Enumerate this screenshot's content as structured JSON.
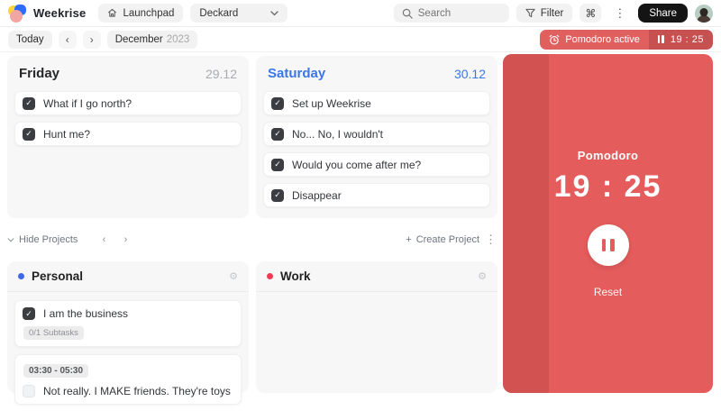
{
  "topbar": {
    "app_name": "Weekrise",
    "launchpad_label": "Launchpad",
    "workspace_selector": "Deckard",
    "search_placeholder": "Search",
    "filter_label": "Filter",
    "command_glyph": "⌘",
    "share_label": "Share"
  },
  "toolbar": {
    "today_label": "Today",
    "month": "December",
    "year": "2023",
    "pomodoro_badge_label": "Pomodoro active",
    "pomodoro_badge_time": "19 : 25"
  },
  "days": [
    {
      "name": "Friday",
      "date": "29.12",
      "tasks": [
        {
          "label": "What if I go north?",
          "checked": true
        },
        {
          "label": "Hunt me?",
          "checked": true
        }
      ]
    },
    {
      "name": "Saturday",
      "date": "30.12",
      "is_today": true,
      "tasks": [
        {
          "label": "Set up Weekrise",
          "checked": true
        },
        {
          "label": "No... No, I wouldn't",
          "checked": true
        },
        {
          "label": "Would you come after me?",
          "checked": true
        },
        {
          "label": "Disappear",
          "checked": true
        }
      ]
    }
  ],
  "projects_bar": {
    "hide_label": "Hide Projects",
    "create_label": "Create Project"
  },
  "projects": [
    {
      "name": "Personal",
      "dot_color": "#3e68e7",
      "tasks": [
        {
          "label": "I am the business",
          "checked": true,
          "subtasks_badge": "0/1 Subtasks"
        },
        {
          "label": "Not really. I MAKE friends. They're toys",
          "checked": false,
          "time_badge": "03:30 - 05:30"
        }
      ]
    },
    {
      "name": "Work",
      "dot_color": "#ee3b55",
      "tasks": []
    }
  ],
  "pomodoro": {
    "title": "Pomodoro",
    "time": "19 : 25",
    "reset_label": "Reset"
  },
  "colors": {
    "accent_blue": "#3b76e8",
    "personal_dot": "#3e68e7",
    "work_dot": "#ee3b55",
    "pomodoro_panel": "#e45c5c",
    "pomodoro_progress": "#d25252",
    "badge_red": "#e06060",
    "badge_dark_red": "#c75151",
    "share_button": "#141414"
  }
}
